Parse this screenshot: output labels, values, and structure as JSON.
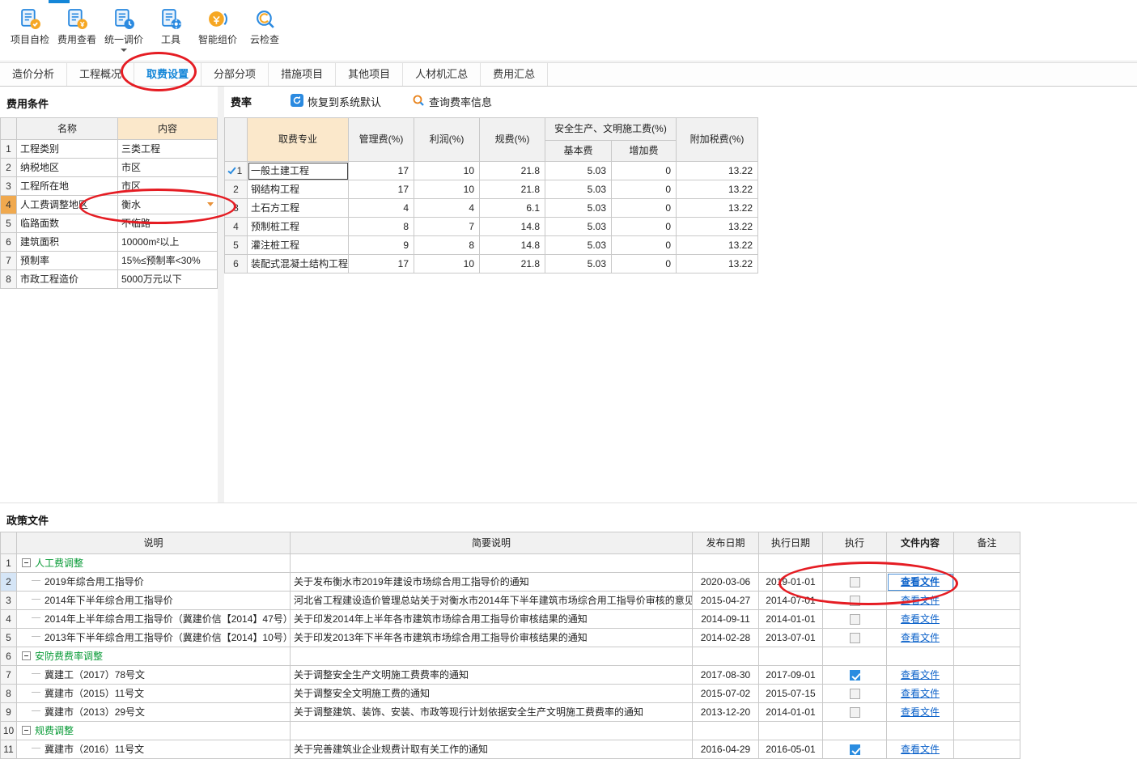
{
  "colors": {
    "accent_blue": "#1486d8",
    "annotation_red": "#e51c23",
    "group_green": "#089a36",
    "link_blue": "#0b61c9",
    "header_orange": "#fbe8cb"
  },
  "toolbar": {
    "items": [
      {
        "label": "项目自检"
      },
      {
        "label": "费用查看"
      },
      {
        "label": "统一调价",
        "has_dropdown": true
      },
      {
        "label": "工具"
      },
      {
        "label": "智能组价"
      },
      {
        "label": "云检查"
      }
    ]
  },
  "tabs": {
    "items": [
      "造价分析",
      "工程概况",
      "取费设置",
      "分部分项",
      "措施项目",
      "其他项目",
      "人材机汇总",
      "费用汇总"
    ],
    "active": "取费设置"
  },
  "fee_conditions": {
    "title": "费用条件",
    "headers": {
      "name": "名称",
      "content": "内容"
    },
    "rows": [
      {
        "num": "1",
        "name": "工程类别",
        "value": "三类工程"
      },
      {
        "num": "2",
        "name": "纳税地区",
        "value": "市区"
      },
      {
        "num": "3",
        "name": "工程所在地",
        "value": "市区"
      },
      {
        "num": "4",
        "name": "人工费调整地区",
        "value": "衡水",
        "dropdown": true,
        "selected": true
      },
      {
        "num": "5",
        "name": "临路面数",
        "value": "不临路"
      },
      {
        "num": "6",
        "name": "建筑面积",
        "value": "10000m²以上"
      },
      {
        "num": "7",
        "name": "预制率",
        "value": "15%≤预制率<30%"
      },
      {
        "num": "8",
        "name": "市政工程造价",
        "value": "5000万元以下"
      }
    ]
  },
  "rates": {
    "title": "费率",
    "buttons": {
      "restore": "恢复到系统默认",
      "query": "查询费率信息"
    },
    "headers": {
      "profession": "取费专业",
      "management": "管理费(%)",
      "profit": "利润(%)",
      "fees": "规费(%)",
      "safety_group": "安全生产、文明施工费(%)",
      "safety_base": "基本费",
      "safety_add": "增加费",
      "surtax": "附加税费(%)"
    },
    "rows": [
      {
        "num": "1",
        "checked": true,
        "selected": true,
        "profession": "一般土建工程",
        "management": "17",
        "profit": "10",
        "fees": "21.8",
        "base": "5.03",
        "add": "0",
        "surtax": "13.22"
      },
      {
        "num": "2",
        "profession": "钢结构工程",
        "management": "17",
        "profit": "10",
        "fees": "21.8",
        "base": "5.03",
        "add": "0",
        "surtax": "13.22"
      },
      {
        "num": "3",
        "profession": "土石方工程",
        "management": "4",
        "profit": "4",
        "fees": "6.1",
        "base": "5.03",
        "add": "0",
        "surtax": "13.22"
      },
      {
        "num": "4",
        "profession": "预制桩工程",
        "management": "8",
        "profit": "7",
        "fees": "14.8",
        "base": "5.03",
        "add": "0",
        "surtax": "13.22"
      },
      {
        "num": "5",
        "profession": "灌注桩工程",
        "management": "9",
        "profit": "8",
        "fees": "14.8",
        "base": "5.03",
        "add": "0",
        "surtax": "13.22"
      },
      {
        "num": "6",
        "profession": "装配式混凝土结构工程",
        "management": "17",
        "profit": "10",
        "fees": "21.8",
        "base": "5.03",
        "add": "0",
        "surtax": "13.22"
      }
    ]
  },
  "policy_files": {
    "title": "政策文件",
    "headers": {
      "name": "说明",
      "desc": "简要说明",
      "publish": "发布日期",
      "execute": "执行日期",
      "exec_flag": "执行",
      "file": "文件内容",
      "remark": "备注"
    },
    "view_file_label": "查看文件",
    "rows": [
      {
        "num": "1",
        "type": "group",
        "name": "人工费调整"
      },
      {
        "num": "2",
        "type": "item",
        "name": "2019年综合用工指导价",
        "desc": "关于发布衡水市2019年建设市场综合用工指导价的通知",
        "publish": "2020-03-06",
        "execute": "2019-01-01",
        "checked": false,
        "selected": true
      },
      {
        "num": "3",
        "type": "item",
        "name": "2014年下半年综合用工指导价",
        "desc": "河北省工程建设造价管理总站关于对衡水市2014年下半年建筑市场综合用工指导价审核的意见",
        "publish": "2015-04-27",
        "execute": "2014-07-01",
        "checked": false
      },
      {
        "num": "4",
        "type": "item",
        "name": "2014年上半年综合用工指导价（冀建价信【2014】47号）",
        "desc": "关于印发2014年上半年各市建筑市场综合用工指导价审核结果的通知",
        "publish": "2014-09-11",
        "execute": "2014-01-01",
        "checked": false
      },
      {
        "num": "5",
        "type": "item",
        "name": "2013年下半年综合用工指导价（冀建价信【2014】10号）",
        "desc": "关于印发2013年下半年各市建筑市场综合用工指导价审核结果的通知",
        "publish": "2014-02-28",
        "execute": "2013-07-01",
        "checked": false
      },
      {
        "num": "6",
        "type": "group",
        "name": "安防费费率调整"
      },
      {
        "num": "7",
        "type": "item",
        "name": "冀建工（2017）78号文",
        "desc": "关于调整安全生产文明施工费费率的通知",
        "publish": "2017-08-30",
        "execute": "2017-09-01",
        "checked": true
      },
      {
        "num": "8",
        "type": "item",
        "name": "冀建市（2015）11号文",
        "desc": "关于调整安全文明施工费的通知",
        "publish": "2015-07-02",
        "execute": "2015-07-15",
        "checked": false
      },
      {
        "num": "9",
        "type": "item",
        "name": "冀建市（2013）29号文",
        "desc": "关于调整建筑、装饰、安装、市政等现行计划依据安全生产文明施工费费率的通知",
        "publish": "2013-12-20",
        "execute": "2014-01-01",
        "checked": false
      },
      {
        "num": "10",
        "type": "group",
        "name": "规费调整"
      },
      {
        "num": "11",
        "type": "item",
        "name": "冀建市（2016）11号文",
        "desc": "关于完善建筑业企业规费计取有关工作的通知",
        "publish": "2016-04-29",
        "execute": "2016-05-01",
        "checked": true
      }
    ]
  },
  "annotations": {
    "color": "#e51c23",
    "count": 3
  }
}
